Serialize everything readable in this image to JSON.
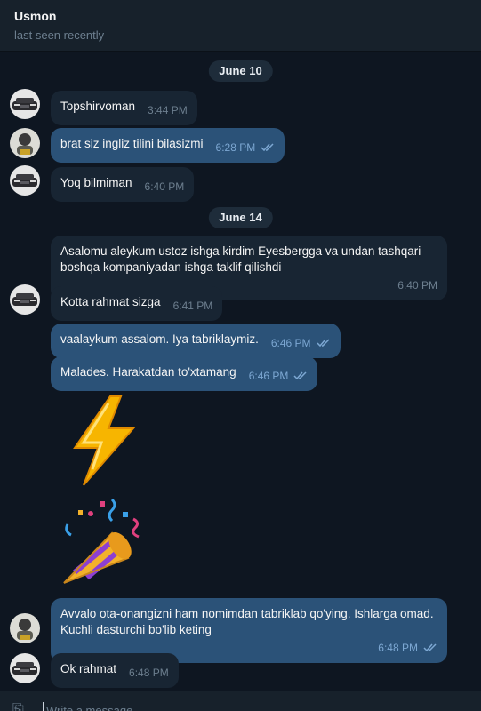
{
  "header": {
    "name": "Usmon",
    "status": "last seen recently"
  },
  "dates": [
    "June 10",
    "June 14"
  ],
  "messages": [
    {
      "text": "Topshirvoman",
      "time": "3:44 PM"
    },
    {
      "text": "brat siz ingliz tilini bilasizmi",
      "time": "6:28 PM"
    },
    {
      "text": "Yoq bilmiman",
      "time": "6:40 PM"
    },
    {
      "text": "Asalomu aleykum ustoz ishga kirdim Eyesbergga va undan tashqari boshqa kompaniyadan ishga taklif qilishdi",
      "time": "6:40 PM"
    },
    {
      "text": "Kotta rahmat sizga",
      "time": "6:41 PM"
    },
    {
      "text": "vaalaykum assalom. Iya tabriklaymiz.",
      "time": "6:46 PM"
    },
    {
      "text": "Malades. Harakatdan to'xtamang",
      "time": "6:46 PM"
    },
    {
      "text": "Avvalo ota-onangizni ham nomimdan tabriklab qo'ying. Ishlarga omad. Kuchli dasturchi bo'lib keting",
      "time": "6:48 PM"
    },
    {
      "text": "Ok rahmat",
      "time": "6:48 PM"
    }
  ],
  "stickers": {
    "first": "lightning-sticker",
    "second": "party-popper-sticker"
  },
  "composer": {
    "placeholder": "Write a message..."
  },
  "colors": {
    "background": "#0e1621",
    "incoming": "#182533",
    "outgoing": "#2b5278",
    "read_ticks": "#7da8d3"
  }
}
